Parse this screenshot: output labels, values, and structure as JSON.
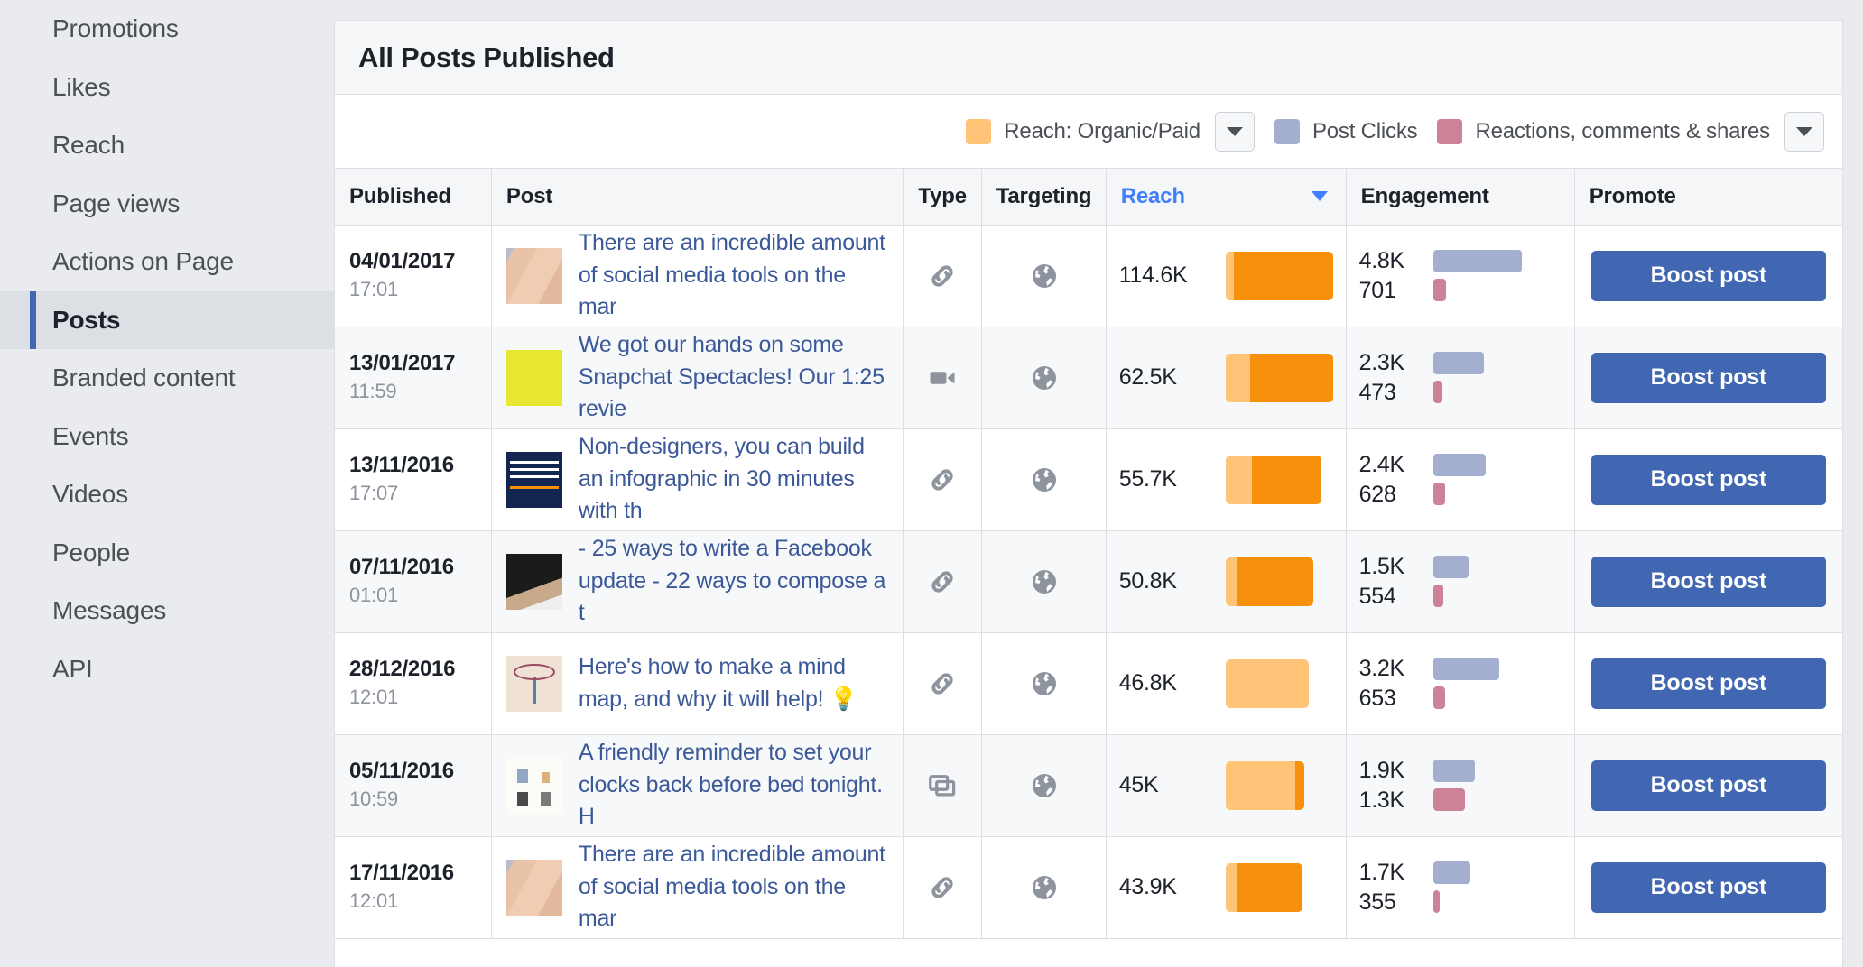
{
  "sidebar": {
    "items": [
      {
        "label": "Promotions",
        "selected": false
      },
      {
        "label": "Likes",
        "selected": false
      },
      {
        "label": "Reach",
        "selected": false
      },
      {
        "label": "Page views",
        "selected": false
      },
      {
        "label": "Actions on Page",
        "selected": false
      },
      {
        "label": "Posts",
        "selected": true
      },
      {
        "label": "Branded content",
        "selected": false
      },
      {
        "label": "Events",
        "selected": false
      },
      {
        "label": "Videos",
        "selected": false
      },
      {
        "label": "People",
        "selected": false
      },
      {
        "label": "Messages",
        "selected": false
      },
      {
        "label": "API",
        "selected": false
      }
    ]
  },
  "card": {
    "title": "All Posts Published"
  },
  "legend": {
    "entries": [
      {
        "label": "Reach: Organic/Paid",
        "color": "#ffc477",
        "has_dropdown": true
      },
      {
        "label": "Post Clicks",
        "color": "#a3aed0",
        "has_dropdown": false
      },
      {
        "label": "Reactions, comments & shares",
        "color": "#cc8397",
        "has_dropdown": true
      }
    ],
    "dropdown_icon": "chevron-down-icon"
  },
  "table": {
    "columns": [
      {
        "key": "published",
        "label": "Published",
        "sorted": false
      },
      {
        "key": "post",
        "label": "Post",
        "sorted": false
      },
      {
        "key": "type",
        "label": "Type",
        "sorted": false
      },
      {
        "key": "targeting",
        "label": "Targeting",
        "sorted": false
      },
      {
        "key": "reach",
        "label": "Reach",
        "sorted": true,
        "sort_direction": "desc"
      },
      {
        "key": "engagement",
        "label": "Engagement",
        "sorted": false
      },
      {
        "key": "promote",
        "label": "Promote",
        "sorted": false
      }
    ],
    "boost_label": "Boost post",
    "rows": [
      {
        "date": "04/01/2017",
        "time": "17:01",
        "text": "There are an incredible amount of social media tools on the mar",
        "thumb": "tn-skin",
        "type_icon": "link-icon",
        "targeting_icon": "globe-icon",
        "reach_label": "114.6K",
        "reach_organic_pct": 8,
        "reach_paid_pct": 92,
        "reach_bar_width_pct": 100,
        "clicks_label": "4.8K",
        "reactions_label": "701",
        "clicks_bar_pct": 100,
        "reactions_bar_pct": 15,
        "promote_label": "Boost post"
      },
      {
        "date": "13/01/2017",
        "time": "11:59",
        "text": "We got our hands on some Snapchat Spectacles! Our 1:25 revie",
        "thumb": "tn-yellow",
        "type_icon": "video-icon",
        "targeting_icon": "globe-icon",
        "reach_label": "62.5K",
        "reach_organic_pct": 23,
        "reach_paid_pct": 77,
        "reach_bar_width_pct": 51,
        "clicks_label": "2.3K",
        "reactions_label": "473",
        "clicks_bar_pct": 58,
        "reactions_bar_pct": 11,
        "promote_label": "Boost post"
      },
      {
        "date": "13/11/2016",
        "time": "17:07",
        "text": "Non-designers, you can build an infographic in 30 minutes with th",
        "thumb": "tn-navy",
        "type_icon": "link-icon",
        "targeting_icon": "globe-icon",
        "reach_label": "55.7K",
        "reach_organic_pct": 27,
        "reach_paid_pct": 73,
        "reach_bar_width_pct": 45,
        "clicks_label": "2.4K",
        "reactions_label": "628",
        "clicks_bar_pct": 60,
        "reactions_bar_pct": 14,
        "promote_label": "Boost post"
      },
      {
        "date": "07/11/2016",
        "time": "01:01",
        "text": "- 25 ways to write a Facebook update - 22 ways to compose a t",
        "thumb": "tn-dark",
        "type_icon": "link-icon",
        "targeting_icon": "globe-icon",
        "reach_label": "50.8K",
        "reach_organic_pct": 13,
        "reach_paid_pct": 87,
        "reach_bar_width_pct": 41,
        "clicks_label": "1.5K",
        "reactions_label": "554",
        "clicks_bar_pct": 40,
        "reactions_bar_pct": 12,
        "promote_label": "Boost post"
      },
      {
        "date": "28/12/2016",
        "time": "12:01",
        "text": "Here's how to make a mind map, and why it will help! 💡",
        "thumb": "tn-mind",
        "type_icon": "link-icon",
        "targeting_icon": "globe-icon",
        "reach_label": "46.8K",
        "reach_organic_pct": 100,
        "reach_paid_pct": 0,
        "reach_bar_width_pct": 39,
        "clicks_label": "3.2K",
        "reactions_label": "653",
        "clicks_bar_pct": 75,
        "reactions_bar_pct": 14,
        "promote_label": "Boost post"
      },
      {
        "date": "05/11/2016",
        "time": "10:59",
        "text": "A friendly reminder to set your clocks back before bed tonight. H",
        "thumb": "tn-clock",
        "type_icon": "album-icon",
        "targeting_icon": "globe-icon",
        "reach_label": "45K",
        "reach_organic_pct": 88,
        "reach_paid_pct": 12,
        "reach_bar_width_pct": 37,
        "clicks_label": "1.9K",
        "reactions_label": "1.3K",
        "clicks_bar_pct": 47,
        "reactions_bar_pct": 36,
        "promote_label": "Boost post"
      },
      {
        "date": "17/11/2016",
        "time": "12:01",
        "text": "There are an incredible amount of social media tools on the mar",
        "thumb": "tn-skin",
        "type_icon": "link-icon",
        "targeting_icon": "globe-icon",
        "reach_label": "43.9K",
        "reach_organic_pct": 14,
        "reach_paid_pct": 86,
        "reach_bar_width_pct": 36,
        "clicks_label": "1.7K",
        "reactions_label": "355",
        "clicks_bar_pct": 42,
        "reactions_bar_pct": 7,
        "promote_label": "Boost post"
      }
    ]
  },
  "chart_data": {
    "type": "bar",
    "title": "All Posts Published",
    "categories": [
      "04/01/2017 17:01",
      "13/01/2017 11:59",
      "13/11/2016 17:07",
      "07/11/2016 01:01",
      "28/12/2016 12:01",
      "05/11/2016 10:59",
      "17/11/2016 12:01"
    ],
    "series": [
      {
        "name": "Reach: Organic/Paid",
        "values": [
          114600,
          62500,
          55700,
          50800,
          46800,
          45000,
          43900
        ],
        "color": "#ffc477"
      },
      {
        "name": "Post Clicks",
        "values": [
          4800,
          2300,
          2400,
          1500,
          3200,
          1900,
          1700
        ],
        "color": "#a3aed0"
      },
      {
        "name": "Reactions, comments & shares",
        "values": [
          701,
          473,
          628,
          554,
          653,
          1300,
          355
        ],
        "color": "#cc8397"
      }
    ],
    "xlabel": "",
    "ylabel": "",
    "grid": false,
    "legend_position": "top-right"
  }
}
